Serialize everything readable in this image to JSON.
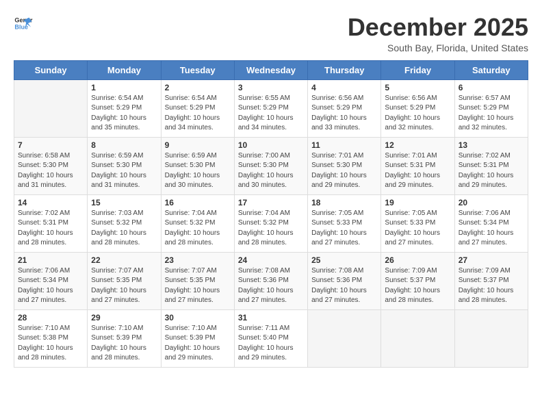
{
  "header": {
    "logo_general": "General",
    "logo_blue": "Blue",
    "month_title": "December 2025",
    "location": "South Bay, Florida, United States"
  },
  "days_of_week": [
    "Sunday",
    "Monday",
    "Tuesday",
    "Wednesday",
    "Thursday",
    "Friday",
    "Saturday"
  ],
  "weeks": [
    [
      {
        "day": "",
        "info": ""
      },
      {
        "day": "1",
        "info": "Sunrise: 6:54 AM\nSunset: 5:29 PM\nDaylight: 10 hours\nand 35 minutes."
      },
      {
        "day": "2",
        "info": "Sunrise: 6:54 AM\nSunset: 5:29 PM\nDaylight: 10 hours\nand 34 minutes."
      },
      {
        "day": "3",
        "info": "Sunrise: 6:55 AM\nSunset: 5:29 PM\nDaylight: 10 hours\nand 34 minutes."
      },
      {
        "day": "4",
        "info": "Sunrise: 6:56 AM\nSunset: 5:29 PM\nDaylight: 10 hours\nand 33 minutes."
      },
      {
        "day": "5",
        "info": "Sunrise: 6:56 AM\nSunset: 5:29 PM\nDaylight: 10 hours\nand 32 minutes."
      },
      {
        "day": "6",
        "info": "Sunrise: 6:57 AM\nSunset: 5:29 PM\nDaylight: 10 hours\nand 32 minutes."
      }
    ],
    [
      {
        "day": "7",
        "info": "Sunrise: 6:58 AM\nSunset: 5:30 PM\nDaylight: 10 hours\nand 31 minutes."
      },
      {
        "day": "8",
        "info": "Sunrise: 6:59 AM\nSunset: 5:30 PM\nDaylight: 10 hours\nand 31 minutes."
      },
      {
        "day": "9",
        "info": "Sunrise: 6:59 AM\nSunset: 5:30 PM\nDaylight: 10 hours\nand 30 minutes."
      },
      {
        "day": "10",
        "info": "Sunrise: 7:00 AM\nSunset: 5:30 PM\nDaylight: 10 hours\nand 30 minutes."
      },
      {
        "day": "11",
        "info": "Sunrise: 7:01 AM\nSunset: 5:30 PM\nDaylight: 10 hours\nand 29 minutes."
      },
      {
        "day": "12",
        "info": "Sunrise: 7:01 AM\nSunset: 5:31 PM\nDaylight: 10 hours\nand 29 minutes."
      },
      {
        "day": "13",
        "info": "Sunrise: 7:02 AM\nSunset: 5:31 PM\nDaylight: 10 hours\nand 29 minutes."
      }
    ],
    [
      {
        "day": "14",
        "info": "Sunrise: 7:02 AM\nSunset: 5:31 PM\nDaylight: 10 hours\nand 28 minutes."
      },
      {
        "day": "15",
        "info": "Sunrise: 7:03 AM\nSunset: 5:32 PM\nDaylight: 10 hours\nand 28 minutes."
      },
      {
        "day": "16",
        "info": "Sunrise: 7:04 AM\nSunset: 5:32 PM\nDaylight: 10 hours\nand 28 minutes."
      },
      {
        "day": "17",
        "info": "Sunrise: 7:04 AM\nSunset: 5:32 PM\nDaylight: 10 hours\nand 28 minutes."
      },
      {
        "day": "18",
        "info": "Sunrise: 7:05 AM\nSunset: 5:33 PM\nDaylight: 10 hours\nand 27 minutes."
      },
      {
        "day": "19",
        "info": "Sunrise: 7:05 AM\nSunset: 5:33 PM\nDaylight: 10 hours\nand 27 minutes."
      },
      {
        "day": "20",
        "info": "Sunrise: 7:06 AM\nSunset: 5:34 PM\nDaylight: 10 hours\nand 27 minutes."
      }
    ],
    [
      {
        "day": "21",
        "info": "Sunrise: 7:06 AM\nSunset: 5:34 PM\nDaylight: 10 hours\nand 27 minutes."
      },
      {
        "day": "22",
        "info": "Sunrise: 7:07 AM\nSunset: 5:35 PM\nDaylight: 10 hours\nand 27 minutes."
      },
      {
        "day": "23",
        "info": "Sunrise: 7:07 AM\nSunset: 5:35 PM\nDaylight: 10 hours\nand 27 minutes."
      },
      {
        "day": "24",
        "info": "Sunrise: 7:08 AM\nSunset: 5:36 PM\nDaylight: 10 hours\nand 27 minutes."
      },
      {
        "day": "25",
        "info": "Sunrise: 7:08 AM\nSunset: 5:36 PM\nDaylight: 10 hours\nand 27 minutes."
      },
      {
        "day": "26",
        "info": "Sunrise: 7:09 AM\nSunset: 5:37 PM\nDaylight: 10 hours\nand 28 minutes."
      },
      {
        "day": "27",
        "info": "Sunrise: 7:09 AM\nSunset: 5:37 PM\nDaylight: 10 hours\nand 28 minutes."
      }
    ],
    [
      {
        "day": "28",
        "info": "Sunrise: 7:10 AM\nSunset: 5:38 PM\nDaylight: 10 hours\nand 28 minutes."
      },
      {
        "day": "29",
        "info": "Sunrise: 7:10 AM\nSunset: 5:39 PM\nDaylight: 10 hours\nand 28 minutes."
      },
      {
        "day": "30",
        "info": "Sunrise: 7:10 AM\nSunset: 5:39 PM\nDaylight: 10 hours\nand 29 minutes."
      },
      {
        "day": "31",
        "info": "Sunrise: 7:11 AM\nSunset: 5:40 PM\nDaylight: 10 hours\nand 29 minutes."
      },
      {
        "day": "",
        "info": ""
      },
      {
        "day": "",
        "info": ""
      },
      {
        "day": "",
        "info": ""
      }
    ]
  ]
}
